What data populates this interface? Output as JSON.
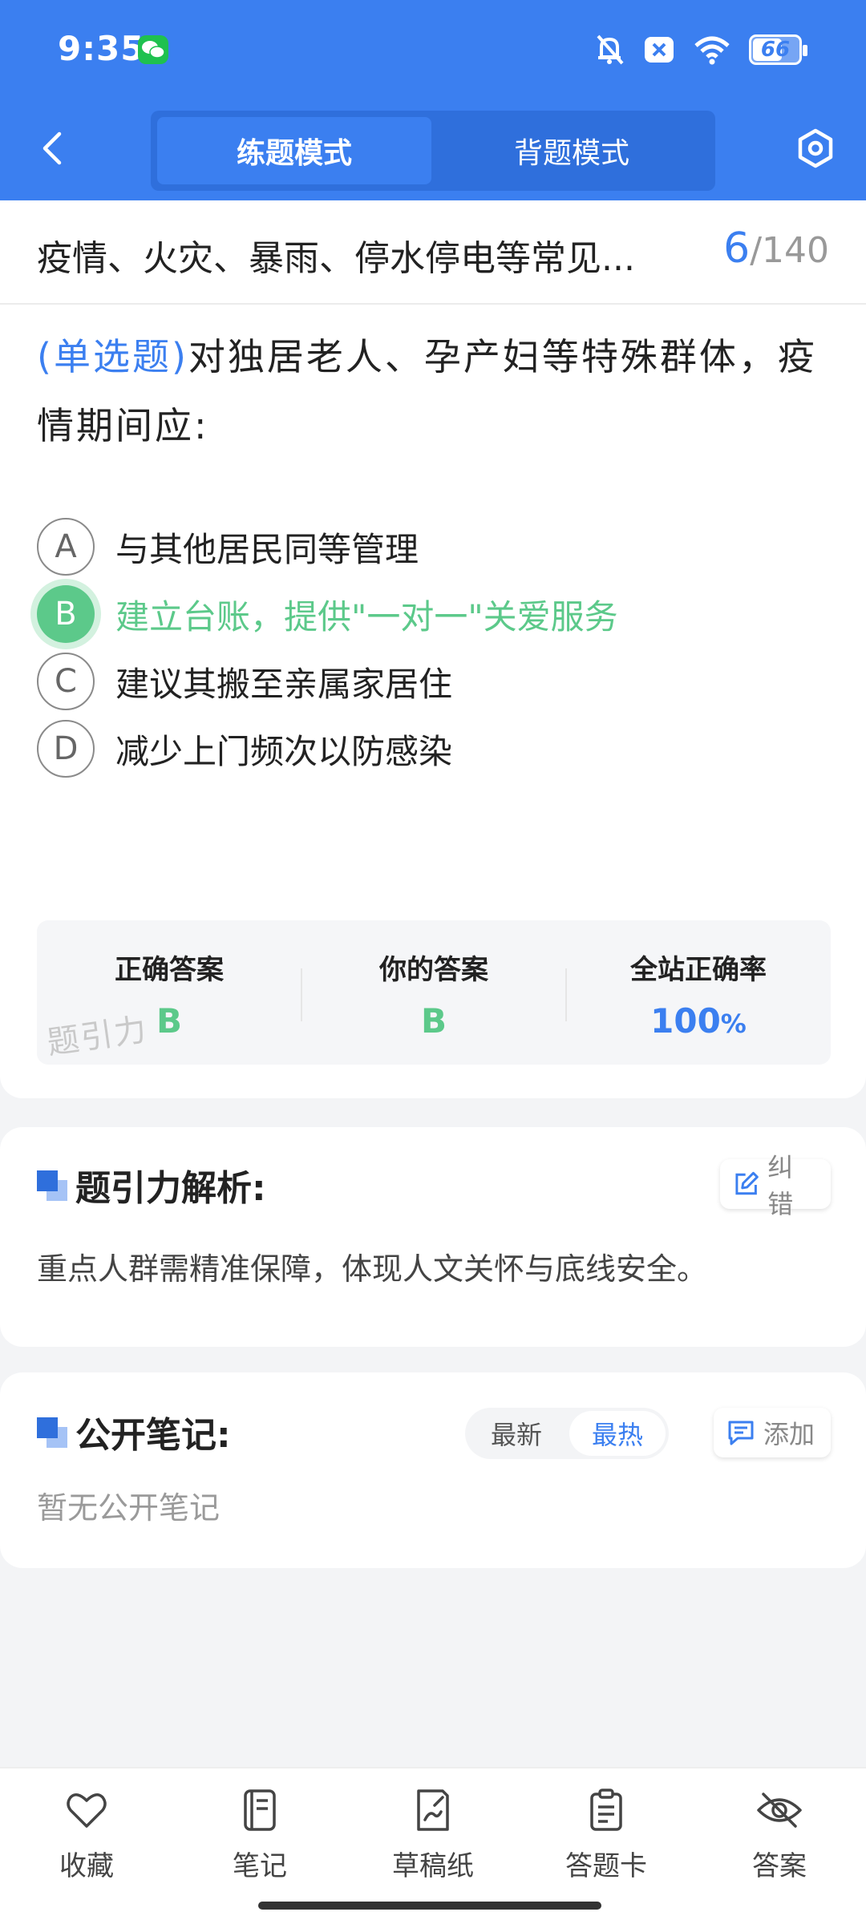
{
  "status_bar": {
    "time": "9:35",
    "battery": "66"
  },
  "nav": {
    "mode_practice": "练题模式",
    "mode_memorize": "背题模式"
  },
  "question": {
    "chapter_title": "疫情、火灾、暴雨、停水停电等常见...",
    "current": "6",
    "separator": "/",
    "total": "140",
    "type_label": "(单选题)",
    "text": "对独居老人、孕产妇等特殊群体，疫情期间应:",
    "options": [
      {
        "letter": "A",
        "text": "与其他居民同等管理"
      },
      {
        "letter": "B",
        "text": "建立台账，提供\"一对一\"关爱服务"
      },
      {
        "letter": "C",
        "text": "建议其搬至亲属家居住"
      },
      {
        "letter": "D",
        "text": "减少上门频次以防感染"
      }
    ],
    "selected_option": "B"
  },
  "summary": {
    "correct_label": "正确答案",
    "correct_value": "B",
    "yours_label": "你的答案",
    "yours_value": "B",
    "rate_label": "全站正确率",
    "rate_value": "100",
    "rate_unit": "%",
    "watermark": "题引力"
  },
  "analysis": {
    "title": "题引力解析:",
    "report_label": "纠错",
    "text": "重点人群需精准保障，体现人文关怀与底线安全。"
  },
  "notes": {
    "title": "公开笔记:",
    "sort_latest": "最新",
    "sort_hot": "最热",
    "add_label": "添加",
    "empty_text": "暂无公开笔记"
  },
  "bottom_bar": {
    "favorite": "收藏",
    "notes": "笔记",
    "scratch": "草稿纸",
    "answer_card": "答题卡",
    "answer": "答案"
  },
  "colors": {
    "primary": "#3b7ff0",
    "correct": "#5cc98a",
    "text": "#222222"
  }
}
